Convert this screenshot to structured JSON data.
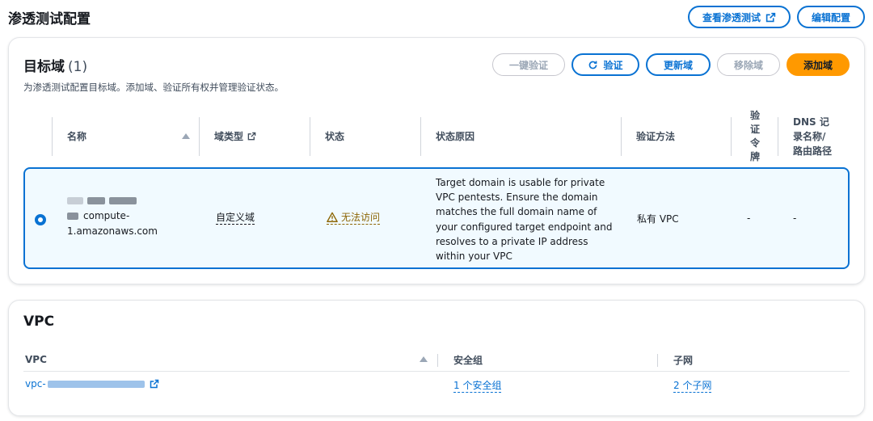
{
  "header": {
    "title": "渗透测试配置",
    "view_pentest_label": "查看渗透测试",
    "edit_config_label": "编辑配置"
  },
  "targets": {
    "title": "目标域",
    "count": "(1)",
    "description": "为渗透测试配置目标域。添加域、验证所有权并管理验证状态。",
    "actions": {
      "verify_all": "一键验证",
      "verify": "验证",
      "update": "更新域",
      "remove": "移除域",
      "add": "添加域"
    },
    "columns": {
      "name": "名称",
      "domain_type": "域类型",
      "status": "状态",
      "status_reason": "状态原因",
      "verify_method": "验证方法",
      "verify_token": "验\n证\n令\n牌",
      "dns": "DNS 记\n录名称/\n路由路径"
    },
    "rows": [
      {
        "name_line2": "compute-",
        "name_line3": "1.amazonaws.com",
        "domain_type": "自定义域",
        "status": "无法访问",
        "status_reason": "Target domain is usable for private VPC pentests. Ensure the domain matches the full domain name of your configured target endpoint and resolves to a private IP address within your VPC",
        "verify_method": "私有 VPC",
        "verify_token": "-",
        "dns": "-"
      }
    ]
  },
  "vpc": {
    "title": "VPC",
    "columns": {
      "vpc": "VPC",
      "security_group": "安全组",
      "subnet": "子网"
    },
    "rows": [
      {
        "vpc_prefix": "vpc-",
        "security_group": "1 个安全组",
        "subnet": "2 个子网"
      }
    ]
  },
  "colors": {
    "link_blue": "#0972d3",
    "primary_orange": "#ff9900",
    "warning": "#8d6605",
    "selected_bg": "#f1faff"
  },
  "icons": [
    "external-link-icon",
    "refresh-icon",
    "warning-icon",
    "sort-icon",
    "radio-selected"
  ]
}
